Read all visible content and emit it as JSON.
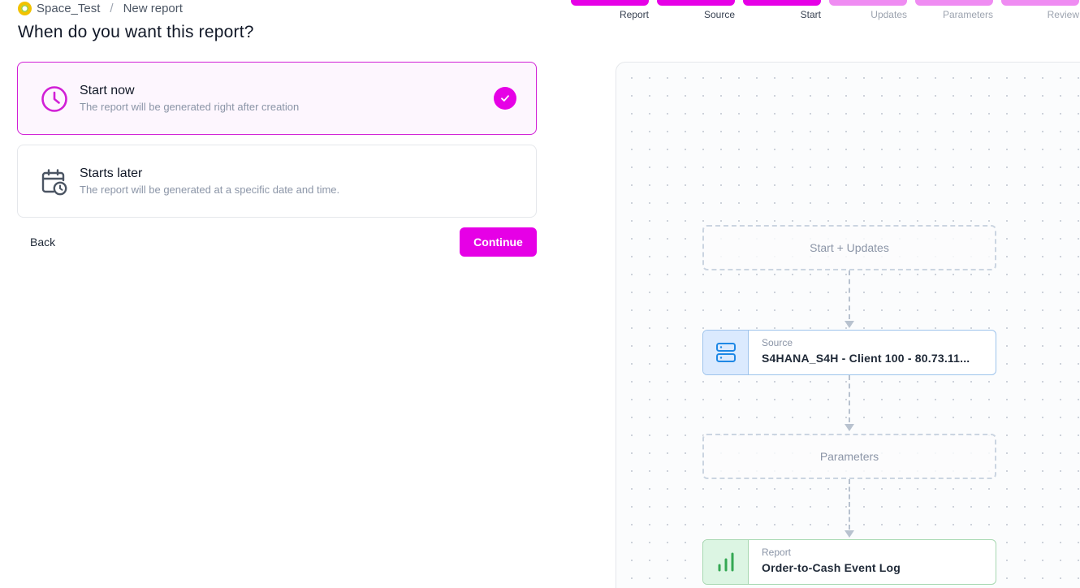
{
  "breadcrumb": {
    "space": "Space_Test",
    "separator": "/",
    "page": "New report"
  },
  "title": "When do you want this report?",
  "stepper": {
    "steps": [
      {
        "label": "Report",
        "state": "done"
      },
      {
        "label": "Source",
        "state": "done"
      },
      {
        "label": "Start",
        "state": "current"
      },
      {
        "label": "Updates",
        "state": "pending"
      },
      {
        "label": "Parameters",
        "state": "pending"
      },
      {
        "label": "Review",
        "state": "pending"
      }
    ]
  },
  "options": [
    {
      "title": "Start now",
      "description": "The report will be generated right after creation",
      "selected": true,
      "icon": "clock-icon"
    },
    {
      "title": "Starts later",
      "description": "The report will be generated at a specific date and time.",
      "selected": false,
      "icon": "calendar-clock-icon"
    }
  ],
  "actions": {
    "back": "Back",
    "continue": "Continue"
  },
  "diagram": {
    "start_node": "Start + Updates",
    "source": {
      "kind": "Source",
      "value": "S4HANA_S4H - Client 100 - 80.73.11..."
    },
    "parameters_node": "Parameters",
    "report": {
      "kind": "Report",
      "value": "Order-to-Cash Event Log"
    }
  },
  "colors": {
    "accent": "#e600e6",
    "accent_light": "#ef8cf2",
    "source": "#1e88e5",
    "report": "#34a853"
  }
}
